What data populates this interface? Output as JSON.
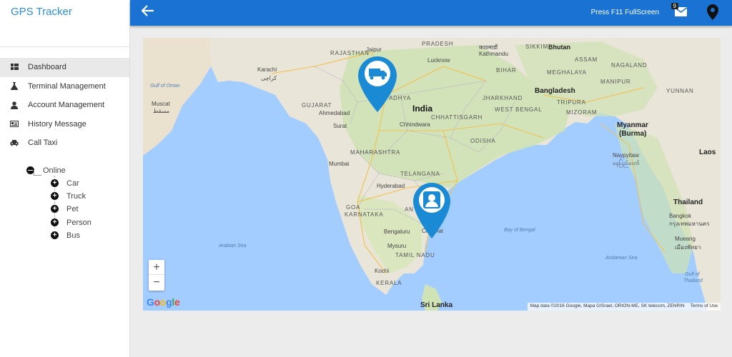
{
  "app": {
    "title": "GPS Tracker"
  },
  "sidebar": {
    "items": [
      {
        "label": "Dashboard",
        "icon": "dashboard-icon"
      },
      {
        "label": "Terminal Management",
        "icon": "flask-icon"
      },
      {
        "label": "Account Management",
        "icon": "user-icon"
      },
      {
        "label": "History Message",
        "icon": "id-card-icon"
      },
      {
        "label": "Call Taxi",
        "icon": "car-icon"
      }
    ],
    "tree": {
      "root": "Online",
      "children": [
        "Car",
        "Truck",
        "Pet",
        "Person",
        "Bus"
      ]
    }
  },
  "header": {
    "fullscreen_hint": "Press F11 FullScreen",
    "mail_badge": "9",
    "accent_color": "#1a73d3"
  },
  "map": {
    "labels": {
      "rajasthan": "RAJASTHAN",
      "jaipur": "Jaipur",
      "pradesh_top": "PRADESH",
      "kathmandu": "Kathmandu",
      "kathmandu_local": "काठमाडौं",
      "sikkim": "SIKKIM",
      "bhutan": "Bhutan",
      "lucknow": "Lucknow",
      "karachi": "Karachi",
      "karachi_local": "کراچی",
      "bihar": "BIHAR",
      "meghalaya": "MEGHALAYA",
      "assam": "ASSAM",
      "nagaland": "NAGALAND",
      "manipur": "MANIPUR",
      "gulf_oman": "Gulf of Oman",
      "muscat": "Muscat",
      "muscat_local": "مسقط",
      "gujarat": "GUJARAT",
      "ahmedabad": "Ahmedabad",
      "madhya": "ADHYA",
      "india": "India",
      "jharkhand": "JHARKHAND",
      "bangladesh": "Bangladesh",
      "tripura": "TRIPURA",
      "mizoram": "MIZORAM",
      "yunnan": "YUNNAN",
      "west_bengal": "WEST BENGAL",
      "chhattisgarh": "CHHATTISGARH",
      "surat": "Surat",
      "chhindwara": "Chhindwara",
      "odisha": "ODISHA",
      "maharashtra": "MAHARASHTRA",
      "myanmar": "Myanmar",
      "burma": "(Burma)",
      "mumbai": "Mumbai",
      "naypyitaw": "Naypyitaw",
      "naypyitaw_local": "နေပြည်တော်",
      "laos": "Laos",
      "telangana": "TELANGANA",
      "hyderabad": "Hyderabad",
      "goa": "GOA",
      "karnataka": "KARNATAKA",
      "andhra": "AN",
      "thailand": "Thailand",
      "bangkok": "Bangkok",
      "bangkok_local": "กรุงเทพมหานคร",
      "bengaluru": "Bengaluru",
      "chennai": "Chennai",
      "bay_bengal": "Bay of Bengal",
      "arabian_sea": "Arabian Sea",
      "mysuru": "Mysuru",
      "tamil_nadu": "TAMIL NADU",
      "andaman_sea": "Andaman Sea",
      "kochi": "Kochi",
      "kerala": "KERALA",
      "gulf_thailand_1": "Gulf of",
      "gulf_thailand_2": "Thailand",
      "sri_lanka": "Sri Lanka",
      "mueang": "Mueang",
      "pattaya": "เมืองพัทยา"
    },
    "zoom_in": "+",
    "zoom_out": "−",
    "google": "Google",
    "attribution": "Map data ©2016 Google, Mapa GISrael, ORION-ME, SK telecom, ZENRIN",
    "terms": "Terms of Use",
    "markers": [
      {
        "type": "truck",
        "icon": "truck-icon"
      },
      {
        "type": "person",
        "icon": "person-icon"
      }
    ]
  }
}
